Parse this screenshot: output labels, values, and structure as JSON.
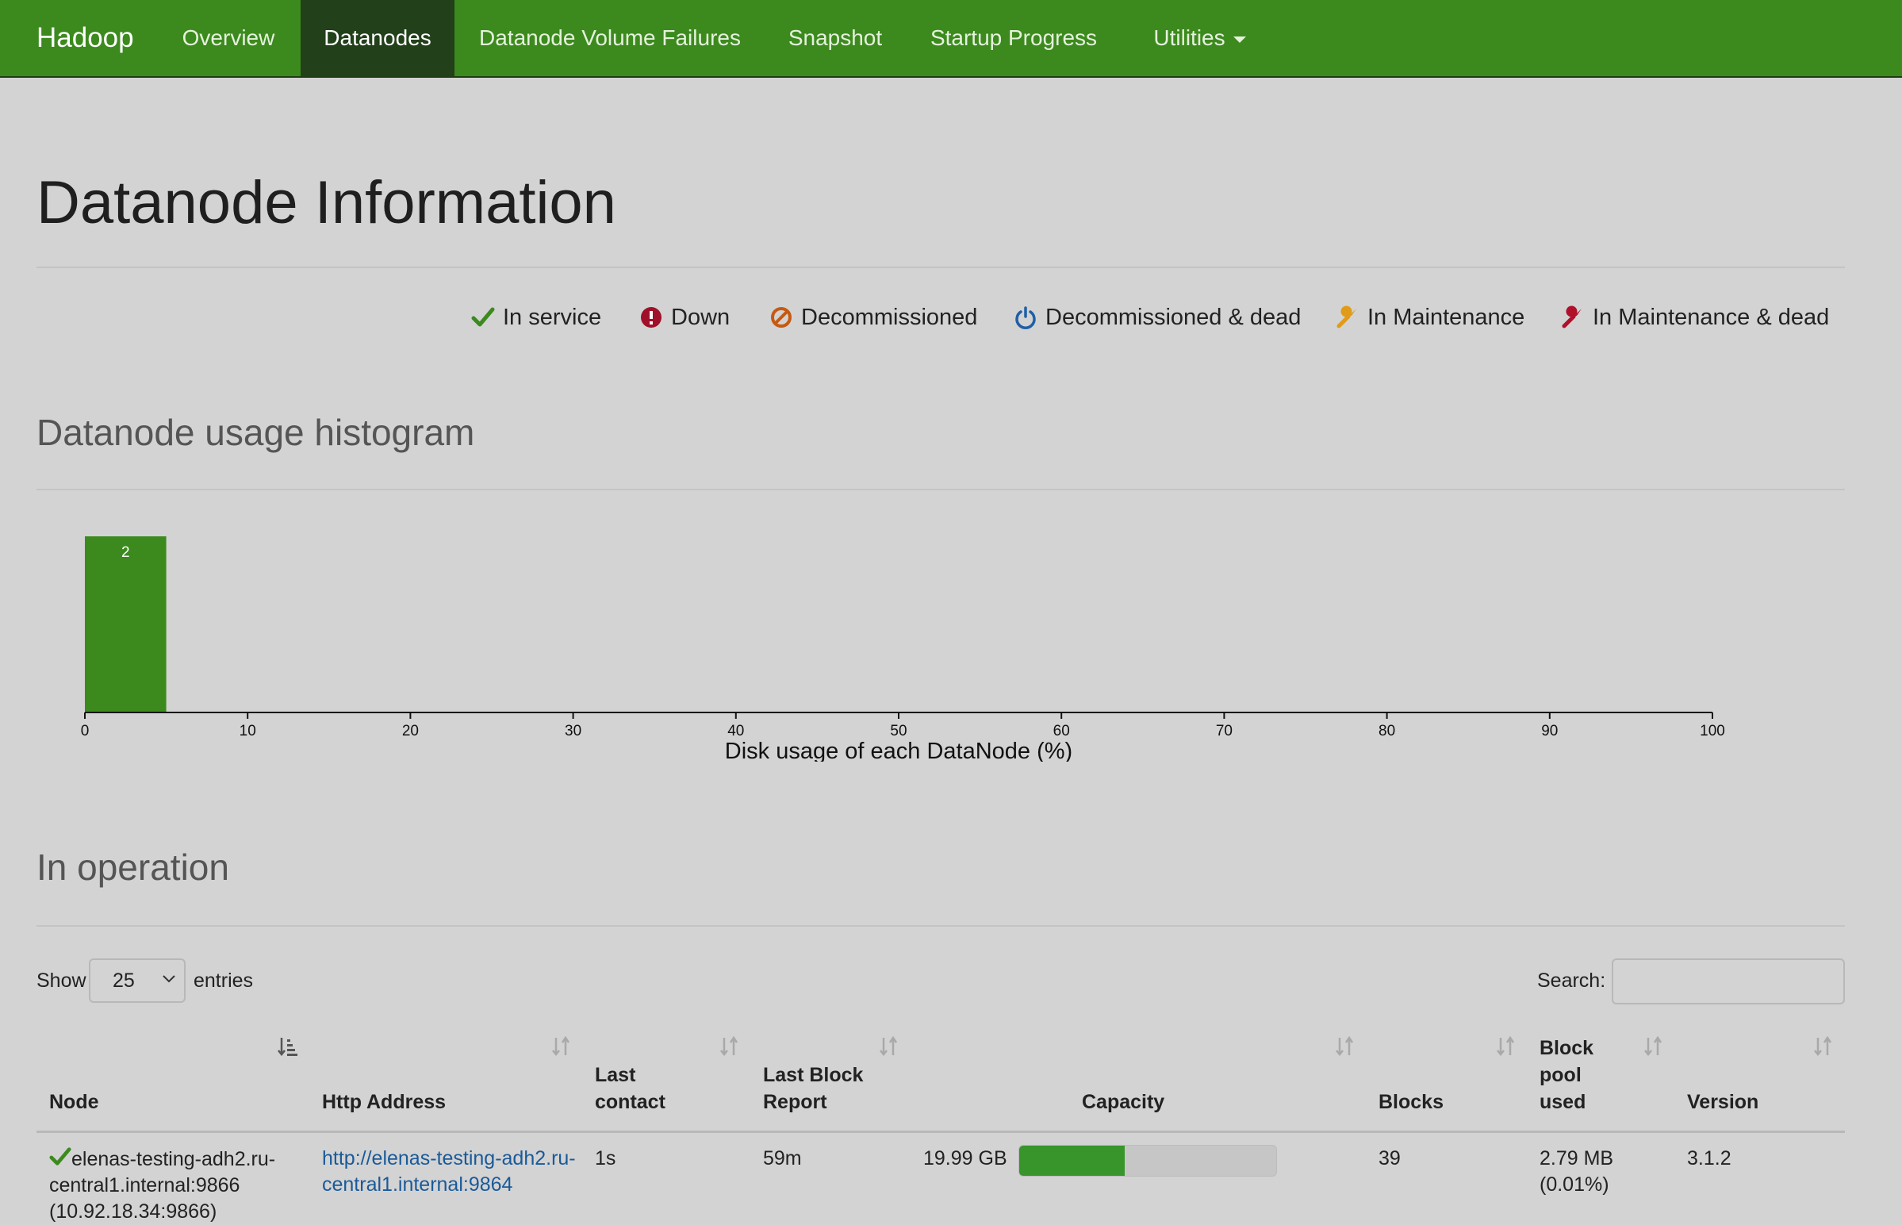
{
  "navbar": {
    "brand": "Hadoop",
    "items": [
      {
        "label": "Overview"
      },
      {
        "label": "Datanodes"
      },
      {
        "label": "Datanode Volume Failures"
      },
      {
        "label": "Snapshot"
      },
      {
        "label": "Startup Progress"
      },
      {
        "label": "Utilities"
      }
    ],
    "active_index": 1
  },
  "page_title": "Datanode Information",
  "legend": [
    {
      "label": "In service",
      "icon": "check-icon",
      "color": "#3c8a1e"
    },
    {
      "label": "Down",
      "icon": "exclamation-circle-icon",
      "color": "#a0102a"
    },
    {
      "label": "Decommissioned",
      "icon": "ban-icon",
      "color": "#c65a10"
    },
    {
      "label": "Decommissioned & dead",
      "icon": "power-icon",
      "color": "#1f5fa6"
    },
    {
      "label": "In Maintenance",
      "icon": "wrench-icon",
      "color": "#e09b1a"
    },
    {
      "label": "In Maintenance & dead",
      "icon": "wrench-icon",
      "color": "#b0102a"
    }
  ],
  "histogram_title": "Datanode usage histogram",
  "chart_data": {
    "type": "bar",
    "xlabel": "Disk usage of each DataNode (%)",
    "xlim": [
      0,
      100
    ],
    "xticks": [
      0,
      10,
      20,
      30,
      40,
      50,
      60,
      70,
      80,
      90,
      100
    ],
    "bins": [
      {
        "x0": 0,
        "x1": 5,
        "count": 2
      }
    ],
    "bar_color": "#3c8a1e"
  },
  "operation_title": "In operation",
  "table_controls": {
    "show_label": "Show",
    "page_size": "25",
    "entries_label": "entries",
    "search_label": "Search:"
  },
  "table": {
    "headers": [
      [
        "Node"
      ],
      [
        "Http Address"
      ],
      [
        "Last",
        "contact"
      ],
      [
        "Last Block",
        "Report"
      ],
      [
        "Capacity"
      ],
      [
        "Blocks"
      ],
      [
        "Block",
        "pool",
        "used"
      ],
      [
        "Version"
      ]
    ],
    "rows": [
      {
        "status_icon": "check-icon",
        "node": [
          "elenas-testing-adh2.ru-",
          "central1.internal:9866",
          "(10.92.18.34:9866)"
        ],
        "http": [
          "http://elenas-testing-adh2.ru-",
          "central1.internal:9864"
        ],
        "last_contact": "1s",
        "last_block_report": "59m",
        "capacity": "19.99 GB",
        "capacity_used_fraction": 0.41,
        "blocks": "39",
        "block_pool_used": [
          "2.79 MB",
          "(0.01%)"
        ],
        "version": "3.1.2"
      }
    ]
  }
}
